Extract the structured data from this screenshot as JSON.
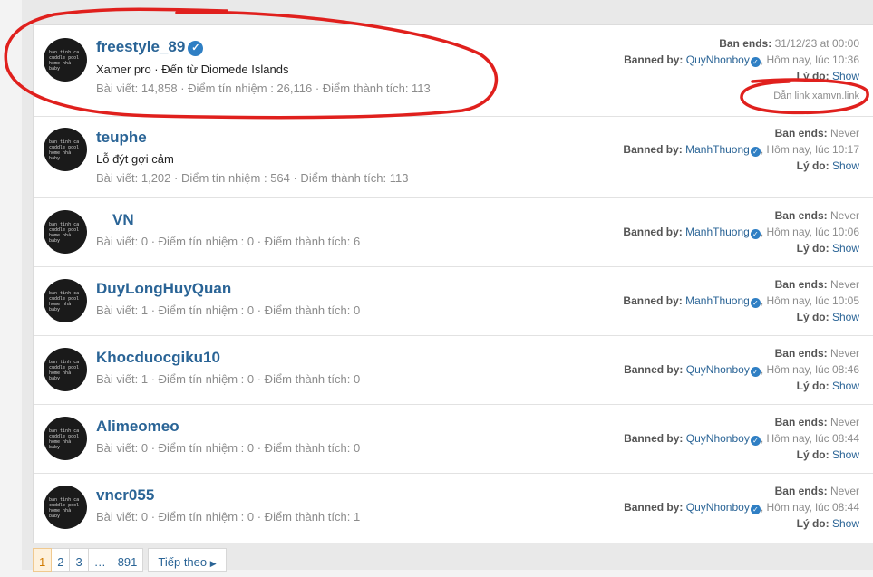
{
  "rows": [
    {
      "username": "freestyle_89",
      "verified": true,
      "subtitle": "Xamer pro · Đến từ Diomede Islands",
      "stats": "Bài viết: 14,858 · Điểm tín nhiệm : 26,116 · Điểm thành tích: 113",
      "ban_ends_label": "Ban ends:",
      "ban_ends": "31/12/23 at 00:00",
      "banned_by_label": "Banned by:",
      "banned_by": "QuyNhonboy",
      "banned_time": ", Hôm nay, lúc 10:36",
      "reason_label": "Lý do:",
      "show": "Show",
      "reason_text": "Dẫn link xamvn.link"
    },
    {
      "username": "teuphe",
      "verified": false,
      "subtitle": "Lỗ đýt gợi cảm",
      "stats": "Bài viết: 1,202 · Điểm tín nhiệm : 564 · Điểm thành tích: 113",
      "ban_ends_label": "Ban ends:",
      "ban_ends": "Never",
      "banned_by_label": "Banned by:",
      "banned_by": "ManhThuong",
      "banned_time": ", Hôm nay, lúc 10:17",
      "reason_label": "Lý do:",
      "show": "Show"
    },
    {
      "username": "VN",
      "verified": false,
      "stats": "Bài viết: 0 · Điểm tín nhiệm : 0 · Điểm thành tích: 6",
      "ban_ends_label": "Ban ends:",
      "ban_ends": "Never",
      "banned_by_label": "Banned by:",
      "banned_by": "ManhThuong",
      "banned_time": ", Hôm nay, lúc 10:06",
      "reason_label": "Lý do:",
      "show": "Show"
    },
    {
      "username": "DuyLongHuyQuan",
      "verified": false,
      "stats": "Bài viết: 1 · Điểm tín nhiệm : 0 · Điểm thành tích: 0",
      "ban_ends_label": "Ban ends:",
      "ban_ends": "Never",
      "banned_by_label": "Banned by:",
      "banned_by": "ManhThuong",
      "banned_time": ", Hôm nay, lúc 10:05",
      "reason_label": "Lý do:",
      "show": "Show"
    },
    {
      "username": "Khocduocgiku10",
      "verified": false,
      "stats": "Bài viết: 1 · Điểm tín nhiệm : 0 · Điểm thành tích: 0",
      "ban_ends_label": "Ban ends:",
      "ban_ends": "Never",
      "banned_by_label": "Banned by:",
      "banned_by": "QuyNhonboy",
      "banned_time": ", Hôm nay, lúc 08:46",
      "reason_label": "Lý do:",
      "show": "Show"
    },
    {
      "username": "Alimeomeo",
      "verified": false,
      "stats": "Bài viết: 0 · Điểm tín nhiệm : 0 · Điểm thành tích: 0",
      "ban_ends_label": "Ban ends:",
      "ban_ends": "Never",
      "banned_by_label": "Banned by:",
      "banned_by": "QuyNhonboy",
      "banned_time": ", Hôm nay, lúc 08:44",
      "reason_label": "Lý do:",
      "show": "Show"
    },
    {
      "username": "vncr055",
      "verified": false,
      "stats": "Bài viết: 0 · Điểm tín nhiệm : 0 · Điểm thành tích: 1",
      "ban_ends_label": "Ban ends:",
      "ban_ends": "Never",
      "banned_by_label": "Banned by:",
      "banned_by": "QuyNhonboy",
      "banned_time": ", Hôm nay, lúc 08:44",
      "reason_label": "Lý do:",
      "show": "Show"
    }
  ],
  "avatar_text": "bạn tình ca\ncuddle pool\nhome nhà\nbaby",
  "pagination": {
    "pages": [
      "1",
      "2",
      "3",
      "…",
      "891"
    ],
    "current": "1",
    "next": "Tiếp theo"
  },
  "colors": {
    "link": "#2a6496",
    "verified": "#2f7fc4",
    "annotation": "#e0201d",
    "current_page_bg": "#fef1dc"
  }
}
